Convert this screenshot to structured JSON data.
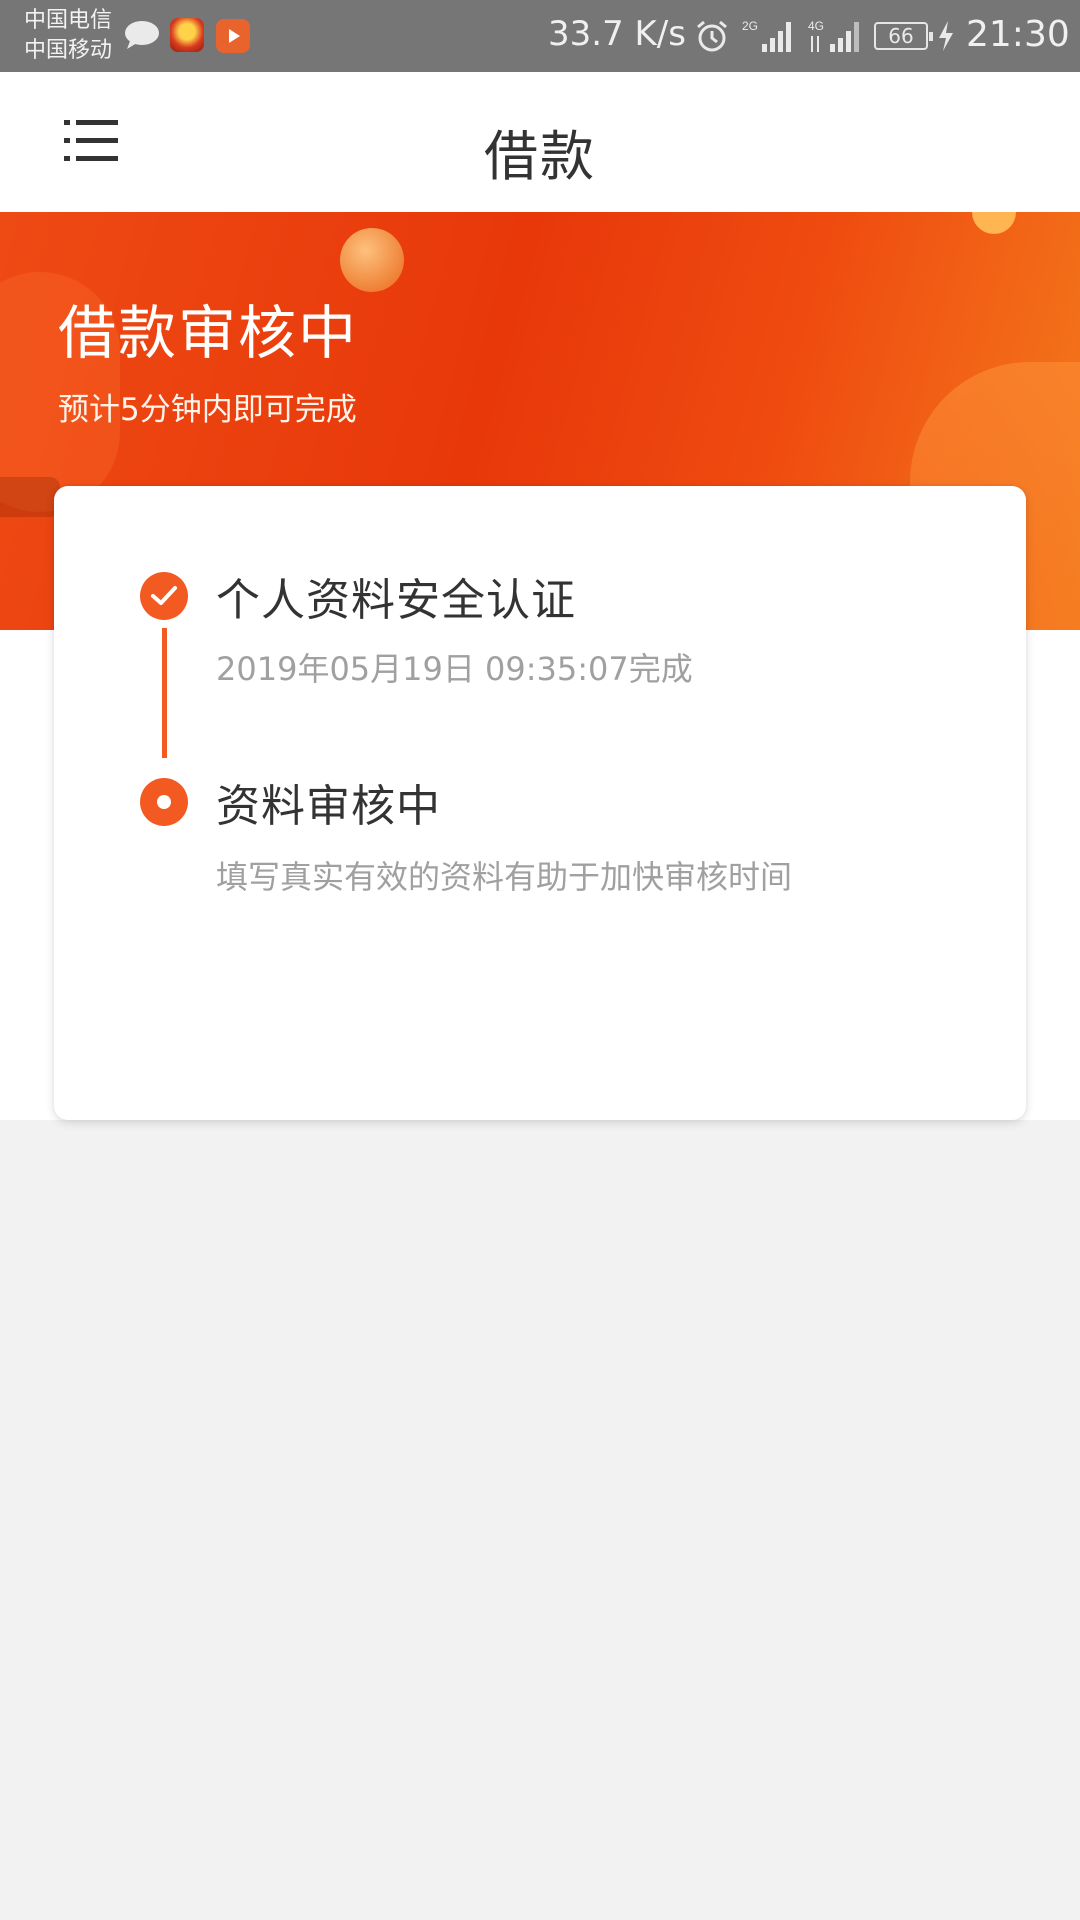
{
  "status_bar": {
    "carrier_1": "中国电信",
    "carrier_2": "中国移动",
    "net_speed": "33.7 K/s",
    "battery_level": "66",
    "time": "21:30",
    "icons": [
      "chat-icon",
      "game-app-icon",
      "video-app-icon",
      "alarm-icon",
      "signal-2g-icon",
      "signal-4g-icon",
      "battery-icon",
      "charging-icon"
    ]
  },
  "nav": {
    "title": "借款",
    "menu_icon": "menu-icon"
  },
  "hero": {
    "title": "借款审核中",
    "subtitle": "预计5分钟内即可完成"
  },
  "steps": [
    {
      "title": "个人资料安全认证",
      "description": "2019年05月19日 09:35:07完成",
      "status": "completed",
      "icon": "check-icon"
    },
    {
      "title": "资料审核中",
      "description": "填写真实有效的资料有助于加快审核时间",
      "status": "current",
      "icon": "current-dot-icon"
    }
  ],
  "colors": {
    "accent": "#f35a22",
    "hero_start": "#ee4a14",
    "hero_end": "#f47a1c",
    "status_bar": "#767676",
    "page_bg": "#f2f2f2"
  }
}
